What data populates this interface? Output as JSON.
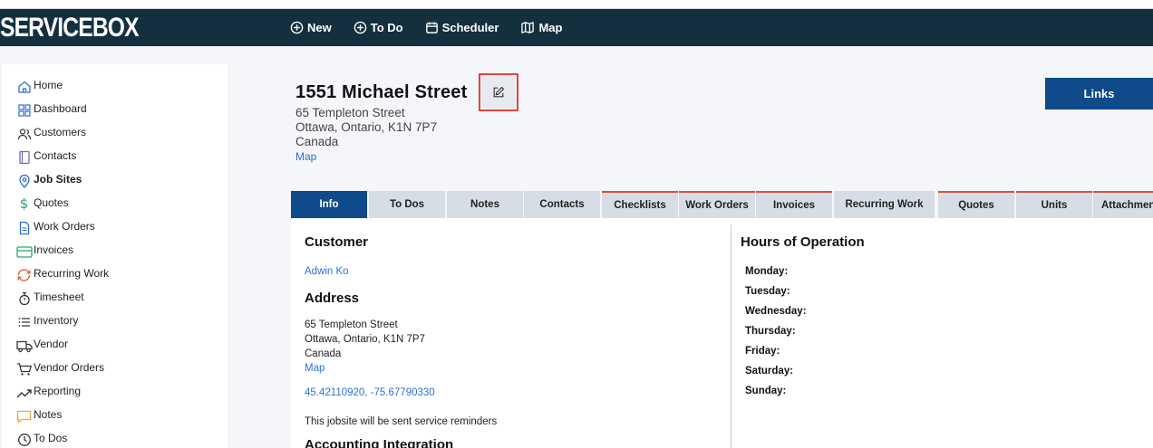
{
  "header": {
    "logo": "SERVICEBOX",
    "nav": [
      {
        "label": "New",
        "icon": "plus-circle-icon"
      },
      {
        "label": "To Do",
        "icon": "plus-circle-icon"
      },
      {
        "label": "Scheduler",
        "icon": "calendar-icon"
      },
      {
        "label": "Map",
        "icon": "map-icon"
      }
    ]
  },
  "sidebar": {
    "items": [
      {
        "label": "Home",
        "icon": "home-icon",
        "color": "#2f6fd6"
      },
      {
        "label": "Dashboard",
        "icon": "grid-icon",
        "color": "#2f6fd6"
      },
      {
        "label": "Customers",
        "icon": "users-icon",
        "color": "#333333"
      },
      {
        "label": "Contacts",
        "icon": "book-icon",
        "color": "#7b61c4"
      },
      {
        "label": "Job Sites",
        "icon": "location-pin-icon",
        "color": "#2f6fd6"
      },
      {
        "label": "Quotes",
        "icon": "dollar-icon",
        "color": "#2aa66b"
      },
      {
        "label": "Work Orders",
        "icon": "document-icon",
        "color": "#2f6fd6"
      },
      {
        "label": "Invoices",
        "icon": "credit-card-icon",
        "color": "#2aa66b"
      },
      {
        "label": "Recurring Work",
        "icon": "refresh-icon",
        "color": "#e0613b"
      },
      {
        "label": "Timesheet",
        "icon": "stopwatch-icon",
        "color": "#333333"
      },
      {
        "label": "Inventory",
        "icon": "list-icon",
        "color": "#333333"
      },
      {
        "label": "Vendor",
        "icon": "truck-icon",
        "color": "#333333"
      },
      {
        "label": "Vendor Orders",
        "icon": "cart-icon",
        "color": "#333333"
      },
      {
        "label": "Reporting",
        "icon": "trend-icon",
        "color": "#333333"
      },
      {
        "label": "Notes",
        "icon": "chat-icon",
        "color": "#e8a93b"
      },
      {
        "label": "To Dos",
        "icon": "clock-icon",
        "color": "#333333"
      }
    ],
    "active": "Job Sites"
  },
  "site": {
    "title": "1551 Michael Street",
    "address_line1": "65 Templeton Street",
    "address_line2": "Ottawa, Ontario, K1N 7P7",
    "country": "Canada",
    "map_link": "Map",
    "links_button": "Links"
  },
  "tabs": [
    "Info",
    "To Dos",
    "Notes",
    "Contacts",
    "Checklists",
    "Work Orders",
    "Invoices",
    "Recurring Work",
    "Quotes",
    "Units",
    "Attachments"
  ],
  "info": {
    "customer_heading": "Customer",
    "customer_name": "Adwin Ko",
    "address_heading": "Address",
    "address_line1": "65 Templeton Street",
    "address_line2": "Ottawa, Ontario, K1N 7P7",
    "country": "Canada",
    "map_link": "Map",
    "coordinates": "45.42110920, -75.67790330",
    "reminder_note": "This jobsite will be sent service reminders",
    "accounting_heading": "Accounting Integration"
  },
  "hours": {
    "heading": "Hours of Operation",
    "days": [
      "Monday:",
      "Tuesday:",
      "Wednesday:",
      "Thursday:",
      "Friday:",
      "Saturday:",
      "Sunday:"
    ]
  }
}
